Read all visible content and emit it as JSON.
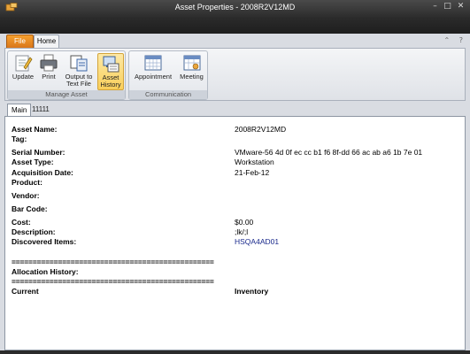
{
  "window": {
    "title": "Asset Properties - 2008R2V12MD",
    "controls": {
      "minimize": "–",
      "maximize": "□",
      "close": "✕"
    }
  },
  "ribbon": {
    "tabs": [
      {
        "label": "File"
      },
      {
        "label": "Home"
      }
    ],
    "right_icons": {
      "help": "?",
      "expand": "⌃"
    },
    "groups": [
      {
        "label": "Manage Asset",
        "buttons": [
          {
            "label": "Update",
            "icon": "update-icon"
          },
          {
            "label": "Print",
            "icon": "printer-icon"
          },
          {
            "label": "Output to Text File",
            "icon": "output-file-icon"
          },
          {
            "label": "Asset History",
            "icon": "asset-history-icon",
            "active": true
          }
        ]
      },
      {
        "label": "Communication",
        "buttons": [
          {
            "label": "Appointment",
            "icon": "calendar-icon"
          },
          {
            "label": "Meeting",
            "icon": "meeting-icon"
          }
        ]
      }
    ]
  },
  "doc_tabs": [
    {
      "label": "Main",
      "active": true
    },
    {
      "label": "11111"
    }
  ],
  "properties": {
    "asset_name": {
      "label": "Asset Name:",
      "value": "2008R2V12MD"
    },
    "tag": {
      "label": "Tag:",
      "value": ""
    },
    "serial_number": {
      "label": "Serial Number:",
      "value": "VMware-56 4d 0f ec cc b1 f6 8f-dd 66 ac ab a6 1b 7e 01"
    },
    "asset_type": {
      "label": "Asset Type:",
      "value": "Workstation"
    },
    "acquisition_date": {
      "label": "Acquisition Date:",
      "value": "21-Feb-12"
    },
    "product": {
      "label": "Product:",
      "value": ""
    },
    "vendor": {
      "label": "Vendor:",
      "value": ""
    },
    "bar_code": {
      "label": "Bar Code:",
      "value": ""
    },
    "cost": {
      "label": "Cost:",
      "value": "$0.00"
    },
    "description": {
      "label": "Description:",
      "value": ";lk/;l"
    },
    "discovered_items": {
      "label": "Discovered Items:",
      "value": "HSQA4AD01"
    }
  },
  "separator": "================================================",
  "allocation": {
    "title": "Allocation History:",
    "columns": [
      "Current",
      "Inventory"
    ]
  },
  "colors": {
    "accent_orange": "#e88a22",
    "link_blue": "#1a2a8c",
    "ribbon_active": "#f9cf5a"
  }
}
